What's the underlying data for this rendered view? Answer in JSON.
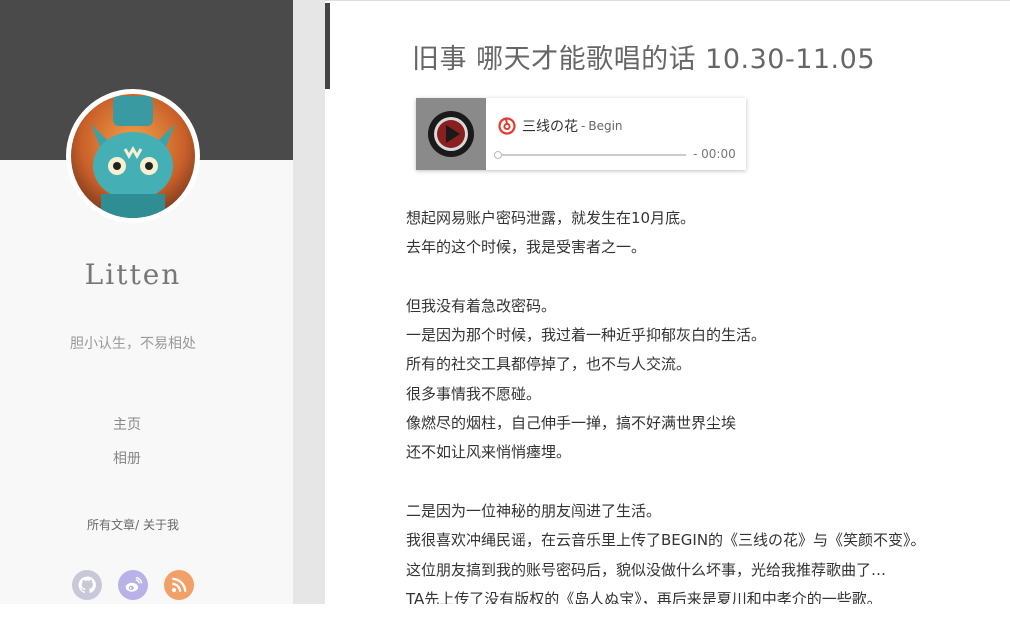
{
  "sidebar": {
    "site_name": "Litten",
    "tagline": "胆小认生，不易相处",
    "nav": [
      {
        "label": "主页"
      },
      {
        "label": "相册"
      }
    ],
    "links": {
      "all_posts": "所有文章",
      "separator": "/",
      "about": "关于我"
    },
    "social": [
      {
        "icon": "github-icon",
        "color": "#c8c8d8"
      },
      {
        "icon": "weibo-icon",
        "color": "#b8b2e8"
      },
      {
        "icon": "rss-icon",
        "color": "#f1a067"
      }
    ]
  },
  "post": {
    "title": "旧事 哪天才能歌唱的话 10.30-11.05"
  },
  "player": {
    "song": "三线の花",
    "separator": "-",
    "artist": "Begin",
    "time": "- 00:00",
    "progress": 0,
    "logo": "netease-music-icon",
    "accent": "#e03c31"
  },
  "article": {
    "lines": [
      "想起网易账户密码泄露，就发生在10月底。",
      "去年的这个时候，我是受害者之一。",
      "",
      "但我没有着急改密码。",
      "一是因为那个时候，我过着一种近乎抑郁灰白的生活。",
      "所有的社交工具都停掉了，也不与人交流。",
      "很多事情我不愿碰。",
      "像燃尽的烟柱，自己伸手一掸，搞不好满世界尘埃",
      "还不如让风来悄悄瘗埋。",
      "",
      "二是因为一位神秘的朋友闯进了生活。",
      "我很喜欢冲绳民谣，在云音乐里上传了BEGIN的《三线の花》与《笑颜不变》。",
      "这位朋友搞到我的账号密码后，貌似没做什么坏事，光给我推荐歌曲了…",
      "TA先上传了没有版权的《岛人ぬ宝》，再后来是夏川和中孝介的一些歌。"
    ]
  }
}
